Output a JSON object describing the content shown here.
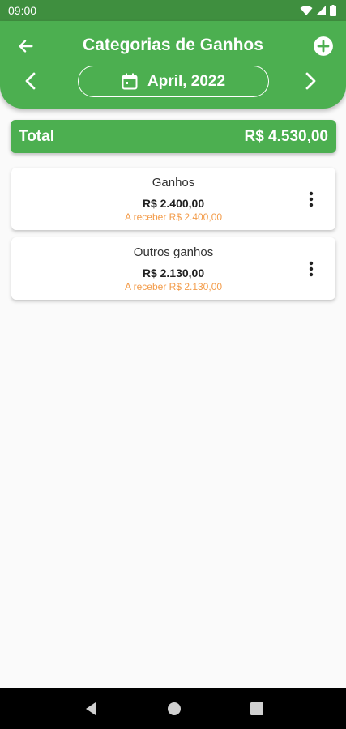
{
  "status_bar": {
    "time": "09:00"
  },
  "header": {
    "title": "Categorias de Ganhos",
    "month": "April, 2022",
    "color": "#4caf50"
  },
  "total": {
    "label": "Total",
    "value": "R$ 4.530,00"
  },
  "categories": [
    {
      "name": "Ganhos",
      "value": "R$ 2.400,00",
      "receivable": "A receber R$ 2.400,00"
    },
    {
      "name": "Outros ganhos",
      "value": "R$ 2.130,00",
      "receivable": "A receber R$ 2.130,00"
    }
  ],
  "icons": {
    "back": "arrow-left-icon",
    "add": "plus-circle-icon",
    "prev": "chevron-left-icon",
    "next": "chevron-right-icon",
    "calendar": "calendar-icon",
    "more": "more-vertical-icon"
  },
  "colors": {
    "accent": "#4caf50",
    "receivable": "#f39c4a",
    "status_bar": "#3f8f3f"
  }
}
